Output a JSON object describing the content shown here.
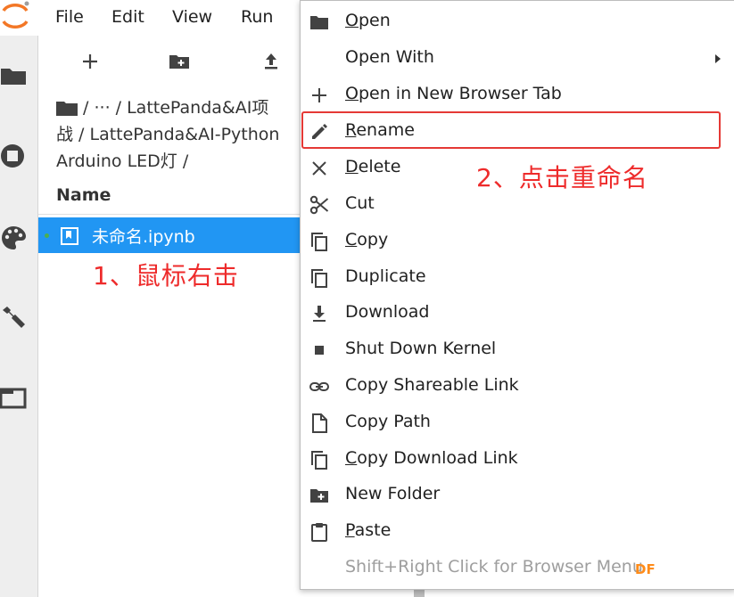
{
  "menubar": {
    "items": [
      "File",
      "Edit",
      "View",
      "Run"
    ]
  },
  "browser": {
    "breadcrumb_line1": "/ ··· / LattePanda&AI项",
    "breadcrumb_line2": "战 / LattePanda&AI-Python",
    "breadcrumb_line3": "Arduino LED灯 /",
    "column_header": "Name",
    "file": {
      "name": "未命名.ipynb",
      "selected": true
    }
  },
  "annotations": {
    "step1": "1、鼠标右击",
    "step2": "2、点击重命名"
  },
  "context_menu": {
    "items": [
      {
        "icon": "folder-icon",
        "label": "Open",
        "underline": "O"
      },
      {
        "icon": "none",
        "label": "Open With",
        "submenu": true
      },
      {
        "icon": "plus-icon",
        "label": "Open in New Browser Tab",
        "underline": "O"
      },
      {
        "icon": "pencil-icon",
        "label": "Rename",
        "underline": "R",
        "highlighted": true
      },
      {
        "icon": "close-icon",
        "label": "Delete",
        "underline": "D"
      },
      {
        "icon": "scissors-icon",
        "label": "Cut"
      },
      {
        "icon": "copy-icon",
        "label": "Copy",
        "underline": "C"
      },
      {
        "icon": "copy-icon",
        "label": "Duplicate"
      },
      {
        "icon": "download-icon",
        "label": "Download"
      },
      {
        "icon": "stop-icon",
        "label": "Shut Down Kernel"
      },
      {
        "icon": "link-icon",
        "label": "Copy Shareable Link"
      },
      {
        "icon": "file-icon",
        "label": "Copy Path"
      },
      {
        "icon": "copy-icon",
        "label": "Copy Download Link",
        "underline": "C"
      },
      {
        "icon": "new-folder-icon",
        "label": "New Folder"
      },
      {
        "icon": "clipboard-icon",
        "label": "Paste",
        "underline": "P"
      },
      {
        "icon": "none",
        "label": "Shift+Right Click for Browser Menu",
        "disabled": true
      }
    ]
  },
  "watermark": "DF",
  "colors": {
    "accent": "#2196f3",
    "annotation": "#ee2b2b",
    "highlight_box": "#e53935"
  }
}
